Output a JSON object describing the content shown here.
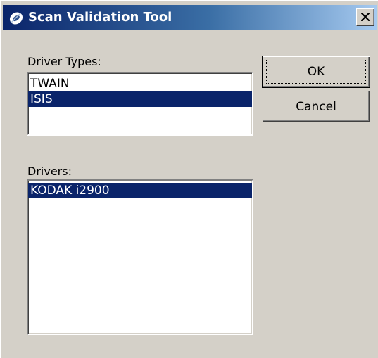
{
  "window": {
    "title": "Scan Validation Tool",
    "title_icon": "app-icon",
    "close_glyph": "✕"
  },
  "driver_types": {
    "label": "Driver Types:",
    "items": [
      {
        "label": "TWAIN",
        "selected": false
      },
      {
        "label": "ISIS",
        "selected": true
      }
    ]
  },
  "drivers": {
    "label": "Drivers:",
    "items": [
      {
        "label": "KODAK i2900",
        "selected": true
      }
    ]
  },
  "buttons": {
    "ok_label": "OK",
    "cancel_label": "Cancel"
  },
  "colors": {
    "selection": "#0a246a",
    "title_gradient_start": "#0a246a",
    "title_gradient_end": "#a6caf0",
    "dialog_face": "#d4d0c8"
  }
}
